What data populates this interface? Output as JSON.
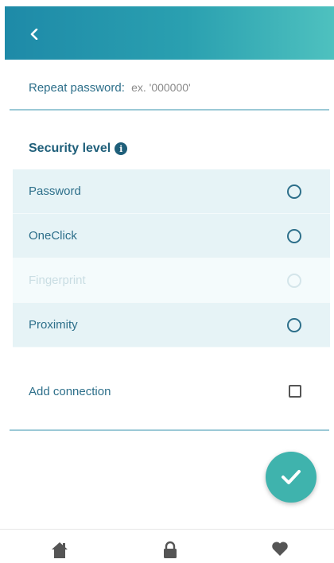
{
  "header": {
    "back_icon": "chevron-left-icon",
    "gradient_start": "#1e8aa8",
    "gradient_end": "#4ec1bf"
  },
  "repeat_password": {
    "label": "Repeat password:",
    "placeholder": "ex. '000000'"
  },
  "security": {
    "title": "Security level",
    "info_icon": "info-icon",
    "options": [
      {
        "label": "Password",
        "enabled": true
      },
      {
        "label": "OneClick",
        "enabled": true
      },
      {
        "label": "Fingerprint",
        "enabled": false
      },
      {
        "label": "Proximity",
        "enabled": true
      }
    ]
  },
  "add_connection": {
    "label": "Add connection",
    "checked": false
  },
  "fab": {
    "icon": "check-icon",
    "color": "#3fb3ad"
  },
  "bottom_nav": {
    "items": [
      "home-icon",
      "lock-icon",
      "heart-icon"
    ]
  }
}
